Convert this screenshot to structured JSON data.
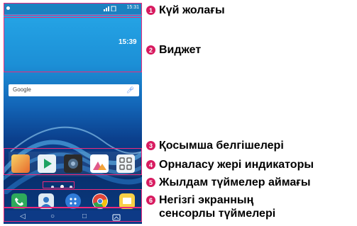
{
  "phone": {
    "status_time": "15:31",
    "widget_time": "15:39",
    "search_brand": "Google"
  },
  "legend": [
    {
      "num": "1",
      "label": "Күй жолағы"
    },
    {
      "num": "2",
      "label": "Виджет"
    },
    {
      "num": "3",
      "label": "Қосымша белгішелері"
    },
    {
      "num": "4",
      "label": "Орналасу жері индикаторы"
    },
    {
      "num": "5",
      "label": "Жылдам түймелер аймағы"
    },
    {
      "num": "6",
      "label_line1": "Негізгі экранның",
      "label_line2": "сенсорлы түймелері"
    }
  ],
  "colors": {
    "frame": "#ee2a7b",
    "badge": "#d81b60",
    "wallpaper_top": "#27a9e9",
    "wallpaper_bottom": "#0a3a80"
  },
  "icons": {
    "nav": [
      "back-icon",
      "home-icon",
      "recent-apps-icon",
      "capture-icon"
    ],
    "search": "mic-icon"
  }
}
